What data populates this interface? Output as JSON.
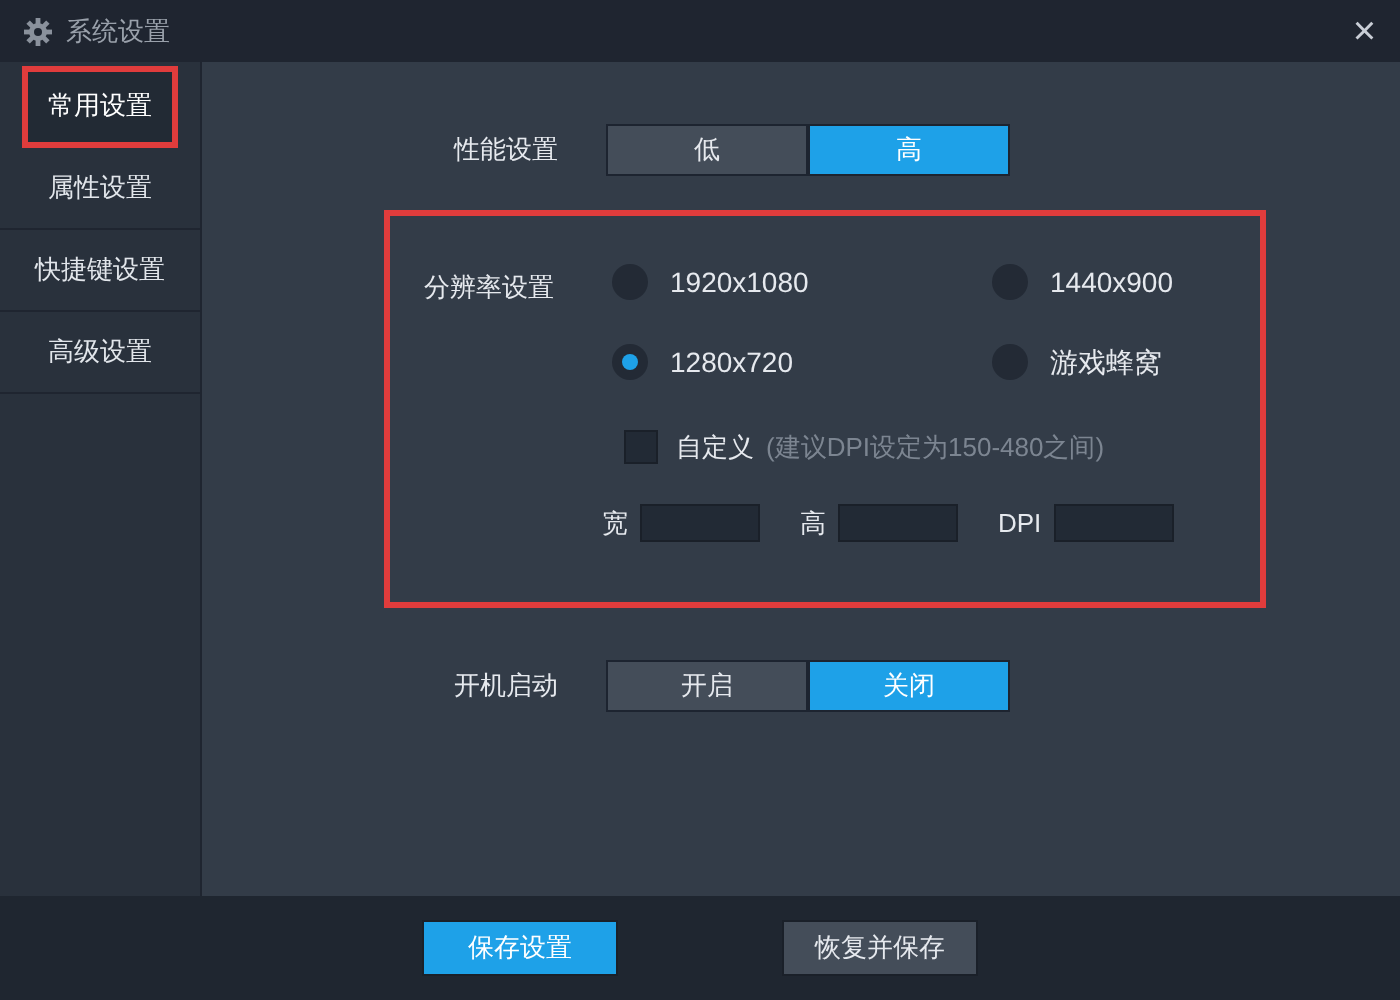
{
  "window": {
    "title": "系统设置",
    "close": "×"
  },
  "sidebar": {
    "items": [
      {
        "label": "常用设置",
        "selected": true,
        "highlighted": true
      },
      {
        "label": "属性设置",
        "selected": false,
        "highlighted": false
      },
      {
        "label": "快捷键设置",
        "selected": false,
        "highlighted": false
      },
      {
        "label": "高级设置",
        "selected": false,
        "highlighted": false
      }
    ]
  },
  "performance": {
    "label": "性能设置",
    "options": [
      {
        "label": "低",
        "selected": false
      },
      {
        "label": "高",
        "selected": true
      }
    ]
  },
  "resolution": {
    "label": "分辨率设置",
    "highlighted": true,
    "options": [
      {
        "label": "1920x1080",
        "selected": false
      },
      {
        "label": "1440x900",
        "selected": false
      },
      {
        "label": "1280x720",
        "selected": true
      },
      {
        "label": "游戏蜂窝",
        "selected": false
      }
    ],
    "custom": {
      "label": "自定义",
      "checked": false,
      "hint": "(建议DPI设定为150-480之间)"
    },
    "fields": [
      {
        "label": "宽"
      },
      {
        "label": "高"
      },
      {
        "label": "DPI"
      }
    ]
  },
  "boot": {
    "label": "开机启动",
    "options": [
      {
        "label": "开启",
        "selected": false
      },
      {
        "label": "关闭",
        "selected": true
      }
    ]
  },
  "buttons": [
    {
      "label": "保存设置",
      "primary": true
    },
    {
      "label": "恢复并保存",
      "primary": false
    }
  ]
}
